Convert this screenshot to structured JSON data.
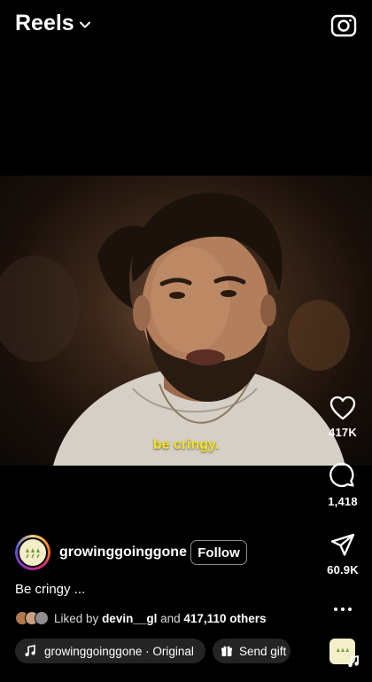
{
  "header": {
    "title": "Reels"
  },
  "video": {
    "caption": "be cringy."
  },
  "actions": {
    "likes": "417K",
    "comments": "1,418",
    "shares": "60.9K"
  },
  "post": {
    "username": "growinggoinggone",
    "follow_label": "Follow",
    "description": "Be cringy ...",
    "liked_by_prefix": "Liked by",
    "liked_by_user": "devin__gl",
    "liked_by_and": "and",
    "liked_by_others": "417,110 others"
  },
  "audio": {
    "label": "growinggoinggone · Original"
  },
  "gift": {
    "label": "Send gift"
  },
  "colors": {
    "background": "#000000",
    "caption": "#f4e31a",
    "text": "#ffffff"
  }
}
